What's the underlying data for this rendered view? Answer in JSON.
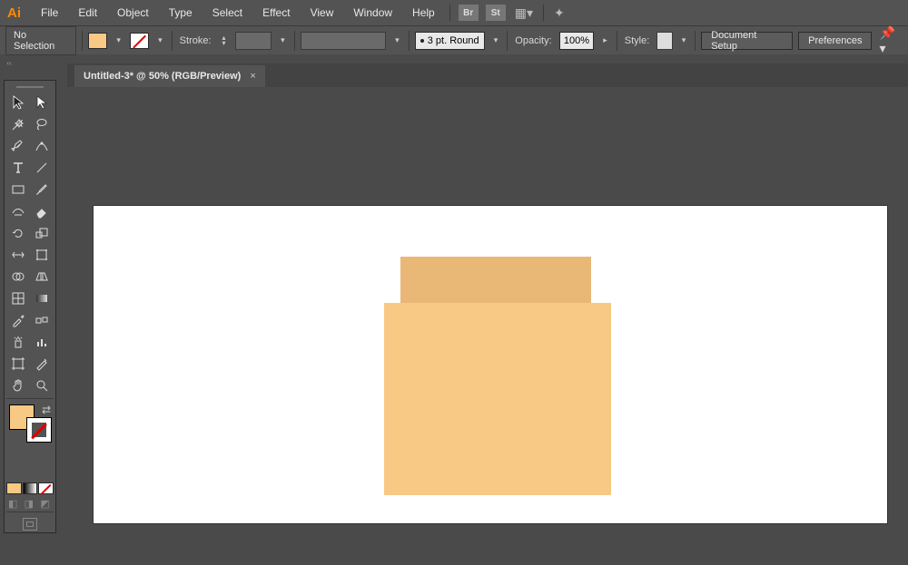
{
  "app_logo": "Ai",
  "menu": [
    "File",
    "Edit",
    "Object",
    "Type",
    "Select",
    "Effect",
    "View",
    "Window",
    "Help"
  ],
  "mb_icons": [
    "Br",
    "St"
  ],
  "controlbar": {
    "selection": "No Selection",
    "stroke_label": "Stroke:",
    "brush_label": "3 pt. Round",
    "opacity_label": "Opacity:",
    "opacity_value": "100%",
    "style_label": "Style:",
    "doc_setup": "Document Setup",
    "prefs": "Preferences"
  },
  "doc": {
    "title": "Untitled-3* @ 50% (RGB/Preview)"
  },
  "colors": {
    "fill": "#f7c984",
    "shape_back": "#e9b877",
    "shape_front": "#f7c984"
  }
}
